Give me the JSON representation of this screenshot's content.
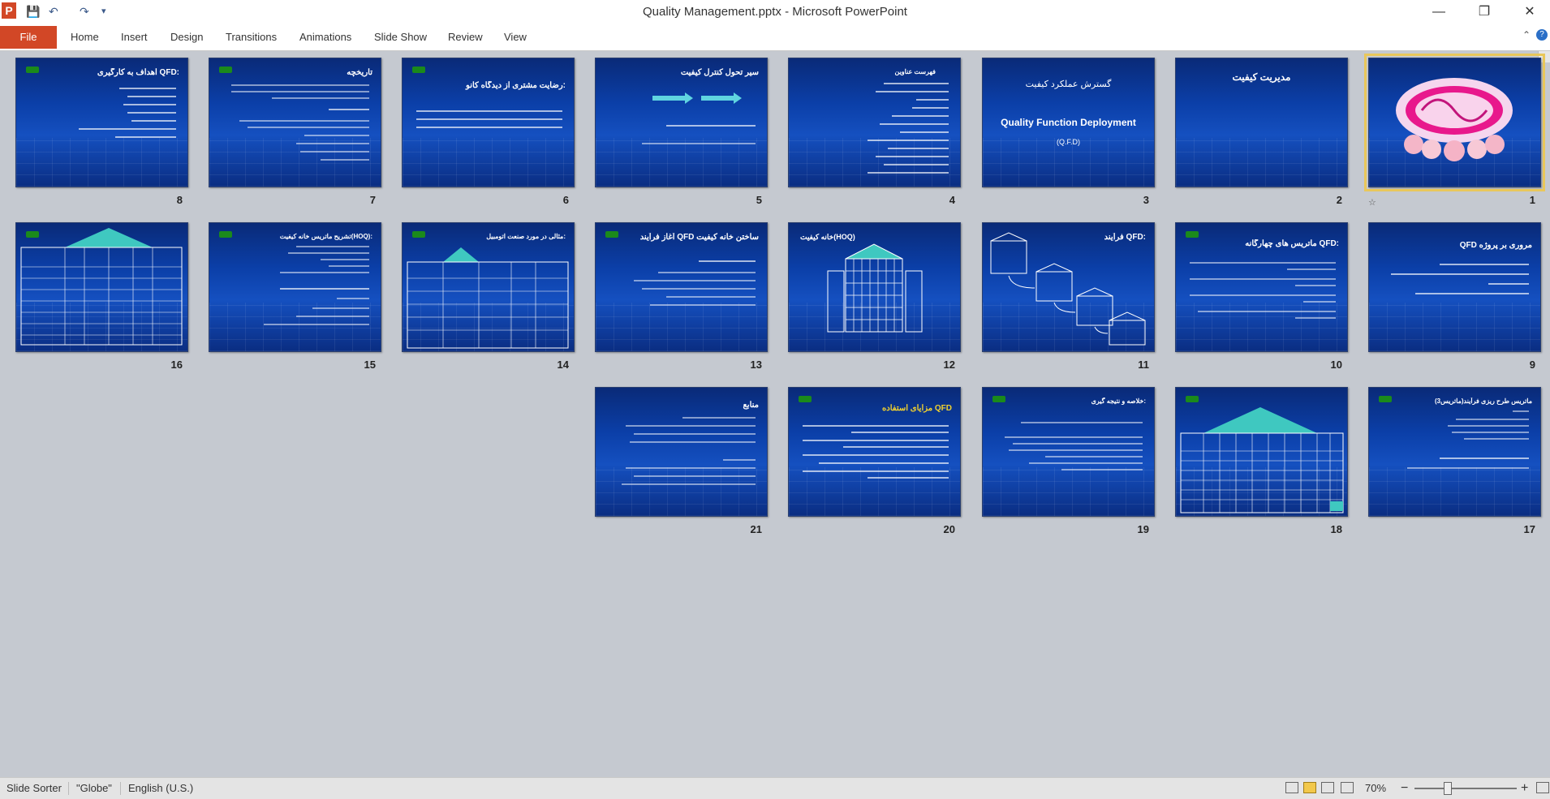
{
  "window": {
    "title": "Quality Management.pptx - Microsoft PowerPoint",
    "minimize": "—",
    "maximize": "❐",
    "close": "✕"
  },
  "qat": {
    "app_icon": "P",
    "save_icon": "💾",
    "undo_icon": "↶",
    "redo_icon": "↷",
    "customize_icon": "▾"
  },
  "ribbon": {
    "file": "File",
    "tabs": [
      "Home",
      "Insert",
      "Design",
      "Transitions",
      "Animations",
      "Slide Show",
      "Review",
      "View"
    ],
    "collapse_icon": "⌃",
    "help_icon": "?"
  },
  "slides": [
    {
      "num": "1",
      "title": ""
    },
    {
      "num": "2",
      "title": "مدیریت کیفیت"
    },
    {
      "num": "3",
      "title": "گسترش عملکرد کیفیت",
      "subtitle": "Quality Function Deployment",
      "sub2": "(Q.F.D)"
    },
    {
      "num": "4",
      "title": "فهرست عناوین"
    },
    {
      "num": "5",
      "title": "سیر تحول کنترل کیفیت"
    },
    {
      "num": "6",
      "title": "رضایت مشتری از دیدگاه کانو:"
    },
    {
      "num": "7",
      "title": "تاریخچه"
    },
    {
      "num": "8",
      "title": "اهداف به کارگیری QFD:"
    },
    {
      "num": "9",
      "title": "QFD مروری بر پروژه"
    },
    {
      "num": "10",
      "title": "ماتریس های چهارگانه QFD:"
    },
    {
      "num": "11",
      "title": "فرآیند QFD:"
    },
    {
      "num": "12",
      "title": "خانه کیفیت(HOQ)"
    },
    {
      "num": "13",
      "title": "آغاز فرآیند QFD ساختن خانه کیفیت"
    },
    {
      "num": "14",
      "title": "مثالی در مورد صنعت اتومبیل:"
    },
    {
      "num": "15",
      "title": "تشریح ماتریس خانه کیفیت(HOQ):"
    },
    {
      "num": "16",
      "title": ""
    },
    {
      "num": "17",
      "title": "ماتریس طرح ریزی فرآیند(ماتریس3)"
    },
    {
      "num": "18",
      "title": ""
    },
    {
      "num": "19",
      "title": "خلاصه و نتیجه گیری:"
    },
    {
      "num": "20",
      "title": "مزایای استفاده QFD"
    },
    {
      "num": "21",
      "title": "منابع"
    }
  ],
  "status": {
    "view": "Slide Sorter",
    "theme": "\"Globe\"",
    "language": "English (U.S.)",
    "zoom": "70%",
    "zoom_out": "−",
    "zoom_in": "+"
  }
}
